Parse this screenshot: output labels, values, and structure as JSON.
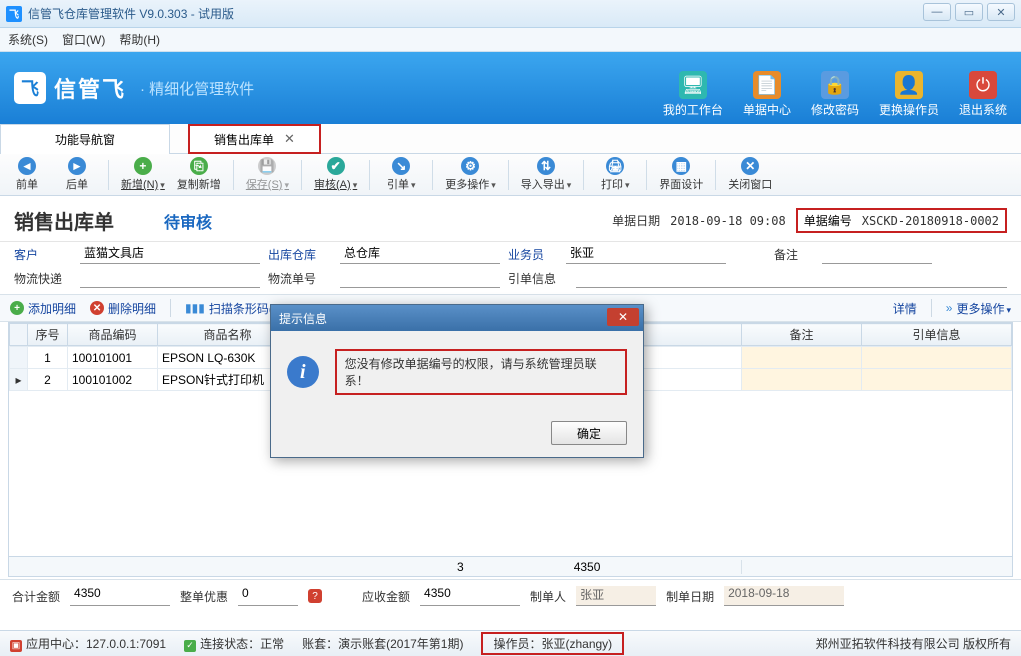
{
  "title": "信管飞仓库管理软件 V9.0.303 - 试用版",
  "menu": {
    "system": "系统(S)",
    "window": "窗口(W)",
    "help": "帮助(H)"
  },
  "banner": {
    "brand": "信管飞",
    "sub": "· 精细化管理软件",
    "buttons": [
      {
        "label": "我的工作台",
        "icon": "desktop"
      },
      {
        "label": "单据中心",
        "icon": "doc"
      },
      {
        "label": "修改密码",
        "icon": "lock"
      },
      {
        "label": "更换操作员",
        "icon": "user"
      },
      {
        "label": "退出系统",
        "icon": "power"
      }
    ]
  },
  "tabs": {
    "nav": "功能导航窗",
    "active": "销售出库单"
  },
  "toolbar": {
    "prev": "前单",
    "next": "后单",
    "new": "新增(N)",
    "copy": "复制新增",
    "save": "保存(S)",
    "audit": "审核(A)",
    "ref": "引单",
    "more": "更多操作",
    "io": "导入导出",
    "print": "打印",
    "ui": "界面设计",
    "close": "关闭窗口"
  },
  "doc": {
    "title": "销售出库单",
    "status": "待审核",
    "date_label": "单据日期",
    "date": "2018-09-18 09:08",
    "no_label": "单据编号",
    "no": "XSCKD-20180918-0002"
  },
  "form": {
    "customer_label": "客户",
    "customer": "蓝猫文具店",
    "warehouse_label": "出库仓库",
    "warehouse": "总仓库",
    "sales_label": "业务员",
    "sales": "张亚",
    "remark_label": "备注",
    "remark": "",
    "express_label": "物流快递",
    "express": "",
    "expressno_label": "物流单号",
    "expressno": "",
    "refinfo_label": "引单信息",
    "refinfo": ""
  },
  "subtoolbar": {
    "add": "添加明细",
    "del": "删除明细",
    "scan": "扫描条形码(M)",
    "detail": "详情",
    "more": "更多操作"
  },
  "grid": {
    "headers": {
      "seq": "序号",
      "code": "商品编码",
      "name": "商品名称",
      "remark": "备注",
      "ref": "引单信息"
    },
    "rows": [
      {
        "seq": "1",
        "code": "100101001",
        "name": "EPSON LQ-630K"
      },
      {
        "seq": "2",
        "code": "100101002",
        "name": "EPSON针式打印机"
      }
    ],
    "footer": {
      "count": "3",
      "sum": "4350"
    }
  },
  "totals": {
    "total_label": "合计金额",
    "total": "4350",
    "discount_label": "整单优惠",
    "discount": "0",
    "receivable_label": "应收金额",
    "receivable": "4350",
    "maker_label": "制单人",
    "maker": "张亚",
    "makedate_label": "制单日期",
    "makedate": "2018-09-18"
  },
  "status": {
    "app_center": "应用中心：127.0.0.1:7091",
    "conn": "连接状态：正常",
    "book": "账套：演示账套(2017年第1期)",
    "operator": "操作员：张亚(zhangy)",
    "copyright": "郑州亚拓软件科技有限公司  版权所有"
  },
  "dialog": {
    "title": "提示信息",
    "message": "您没有修改单据编号的权限，请与系统管理员联系！",
    "ok": "确定"
  }
}
